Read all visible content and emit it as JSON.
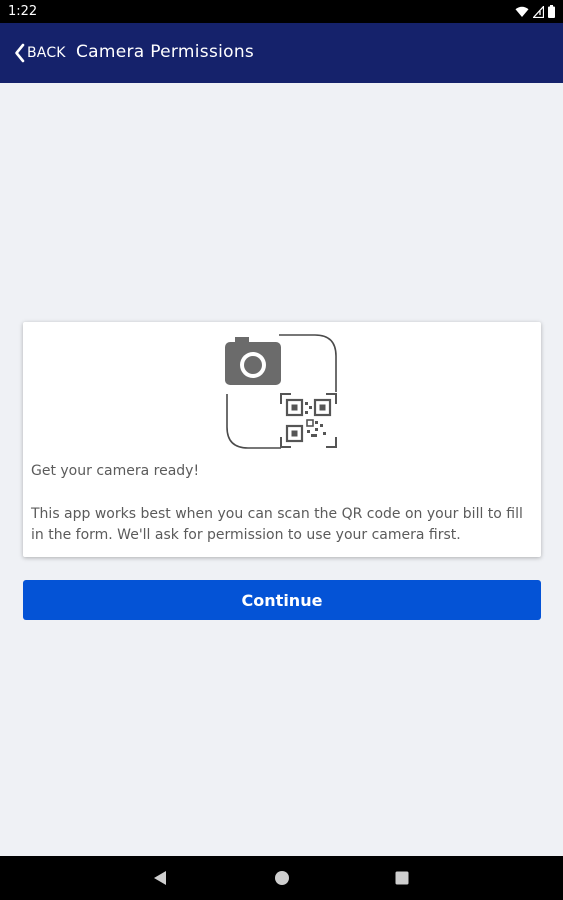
{
  "status_bar": {
    "time": "1:22",
    "icons": [
      "wifi-icon",
      "signal-icon",
      "battery-icon"
    ]
  },
  "app_bar": {
    "back_label": "BACK",
    "title": "Camera Permissions"
  },
  "card": {
    "illustration_icon": "camera-qr-icon",
    "heading": "Get your camera ready!",
    "body": "This app works best when you can scan the QR code on your bill to fill in the form. We'll ask for permission to use your camera first."
  },
  "continue_button": {
    "label": "Continue"
  },
  "nav_bar": {
    "icons": [
      "back-triangle-icon",
      "home-circle-icon",
      "recents-square-icon"
    ]
  },
  "colors": {
    "app_bar": "#15226b",
    "button": "#0453d6",
    "background": "#eff1f5"
  }
}
